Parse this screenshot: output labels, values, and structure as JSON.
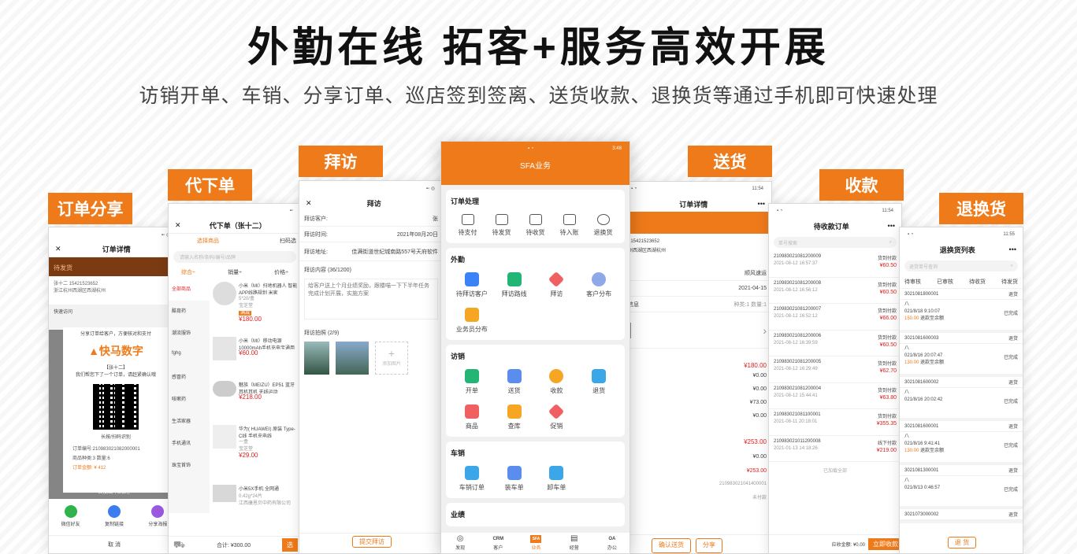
{
  "hero": {
    "title": "外勤在线  拓客+服务高效开展",
    "subtitle": "访销开单、车销、分享订单、巡店签到签离、送货收款、退换货等通过手机即可快速处理"
  },
  "brand_color": "#ef7a1a",
  "tags": {
    "share": "订单分享",
    "proxy": "代下单",
    "visit": "拜访",
    "deliver": "送货",
    "collect": "收款",
    "return": "退换货"
  },
  "phone_share": {
    "nav_title": "订单详情",
    "status": "待发货",
    "customer": "张十二 15421523652",
    "address": "浙江杭州西湖区西湖杭州",
    "shortcut_label": "快速访问",
    "popup_tip": "分享订单给客户，方便核对和支付",
    "logo_text": "快马数字",
    "greeting": "【张十二】",
    "msg": "我们帮您下了一个订单，请赶紧确认哦",
    "qr_caption": "长按/扫码识别",
    "order_no": "订单编号:210983021082000001",
    "goods_count": "商品种类:3    数量:6",
    "amount": "订单金额: ¥ 412",
    "save_hint": "长按图片以保存",
    "share_opts": [
      "微信好友",
      "复制链接",
      "分享海报"
    ],
    "cancel": "取 消"
  },
  "phone_proxy": {
    "nav_title": "代下单（张十二）",
    "tab_select": "选择商品",
    "tab_scan": "扫码选",
    "search_placeholder": "请输入名称/条码/编号/品牌",
    "sorts": [
      "综合÷",
      "销量÷",
      "价格÷"
    ],
    "categories": [
      "全部商品",
      "酷育药",
      "潮流服饰",
      "fghg",
      "感冒药",
      "咳嗽药",
      "生活家器",
      "手机通讯",
      "珠宝首饰"
    ],
    "products": [
      {
        "name": "小米（MI）扫地机器人 智能APP线路规划 米家",
        "spec": "5*20/盒",
        "store": "宝芝堂",
        "badge": "满减",
        "price": "¥180.00"
      },
      {
        "name": "小米（MI）移动电源10000mAh手机充电宝通用",
        "spec": "",
        "store": "",
        "badge": "",
        "price": "¥60.00"
      },
      {
        "name": "魅族（MEIZU）EP51 蓝牙耳机耳机 无线运动",
        "spec": "",
        "store": "",
        "badge": "",
        "price": "¥218.00"
      },
      {
        "name": "华为( HUAWEI) 原装 Type-C线 手机充电线",
        "spec": "一盒",
        "store": "宝芝堂",
        "badge": "",
        "price": "¥29.00"
      },
      {
        "name": "小米5X手机 全网通",
        "spec": "0.42g*24片",
        "store": "江西康恩贝中药有限公司",
        "badge": "",
        "price": ""
      }
    ],
    "total": "合计: ¥300.00",
    "submit": "选"
  },
  "phone_visit": {
    "nav_title": "拜访",
    "fields": [
      {
        "label": "拜访客户:",
        "value": "张"
      },
      {
        "label": "拜访时间:",
        "value": "2021年08月20日"
      },
      {
        "label": "拜访地址:",
        "value": "佳满街道世纪城南路557号天府软件"
      }
    ],
    "content_label": "拜访内容 (36/1200)",
    "content_text": "给客户送上个月业绩奖励，跟楼喵一下下半年任务完成计划开展，实施方案",
    "photo_label": "拜访拍照 (2/9)",
    "add_photo": "添加图片",
    "submit": "提交拜访"
  },
  "phone_sfa": {
    "time": "3:48",
    "title": "SFA业务",
    "sections": [
      {
        "title": "订单处理",
        "items": [
          "待支付",
          "待发货",
          "待收货",
          "待入账",
          "退换货"
        ]
      },
      {
        "title": "外勤",
        "items": [
          "待拜访客户",
          "拜访路线",
          "拜访",
          "客户分布",
          "业务员分布"
        ]
      },
      {
        "title": "访销",
        "items": [
          "开单",
          "送货",
          "收款",
          "退货",
          "商品",
          "查库",
          "促销"
        ]
      },
      {
        "title": "车销",
        "items": [
          "车销订单",
          "装车单",
          "卸车单"
        ]
      },
      {
        "title": "业绩",
        "items": []
      }
    ],
    "tabbar": [
      "发现",
      "客户",
      "业务",
      "经营",
      "办公"
    ]
  },
  "phone_deliver": {
    "time": "11:54",
    "nav_title": "订单详情",
    "phone": ": 15421523652",
    "addr": "州西湖区西湖杭州",
    "express": "顺风速运",
    "date": "2021-04-15",
    "info_label": "信息",
    "info_count": "种类:1 数量:1",
    "amounts": [
      "¥180.00",
      "¥0.00",
      "¥0.00",
      "¥73.00",
      "¥0.00",
      "¥253.00",
      "¥0.00",
      "¥253.00"
    ],
    "order_no": "210983021041400001",
    "status": "未付款",
    "confirm": "确认送货",
    "share": "分享"
  },
  "phone_collect": {
    "time": "11:54",
    "nav_title": "待收款订单",
    "search_placeholder": "单号搜索",
    "orders": [
      {
        "no": "210983021081200009",
        "time": "2021-08-12 16:57:37",
        "type": "货到付款",
        "amt": "¥60.50"
      },
      {
        "no": "210983021081200008",
        "time": "2021-08-12 16:56:12",
        "type": "货到付款",
        "amt": "¥60.50"
      },
      {
        "no": "210983021081200007",
        "time": "2021-08-12 16:52:12",
        "type": "货到付款",
        "amt": "¥66.00"
      },
      {
        "no": "210983021081200006",
        "time": "2021-08-12 16:39:59",
        "type": "货到付款",
        "amt": "¥60.50"
      },
      {
        "no": "210983021081200005",
        "time": "2021-08-12 16:29:49",
        "type": "货到付款",
        "amt": "¥62.70"
      },
      {
        "no": "210983021081200004",
        "time": "2021-08-12 15:44:41",
        "type": "货到付款",
        "amt": "¥63.80"
      },
      {
        "no": "210983021081100001",
        "time": "2021-08-11 20:18:01",
        "type": "货到付款",
        "amt": "¥355.35"
      },
      {
        "no": "210983021011200008",
        "time": "2021-01-13 14:18:26",
        "type": "线下付款",
        "amt": "¥219.00"
      }
    ],
    "end_tip": "已加载全部",
    "due": "应收金额: ¥0.00",
    "collect_all": "立即收款"
  },
  "phone_return": {
    "time": "11:55",
    "nav_title": "退换货列表",
    "search_placeholder": "退货单号查询",
    "tabs": [
      "待审核",
      "已审核",
      "待收货",
      "待发货"
    ],
    "items": [
      {
        "no": "3021081800001",
        "type": "退货",
        "name": "八",
        "time": "021/8/18 9:10:07",
        "money": "150.00",
        "note": "退款至余额",
        "state": "已完成"
      },
      {
        "no": "3021081600003",
        "type": "退货",
        "name": "八",
        "time": "021/8/16 20:07:47",
        "money": "130.00",
        "note": "退款至余额",
        "state": "已完成"
      },
      {
        "no": "3021081600002",
        "type": "退货",
        "name": "八",
        "time": "021/8/16 20:02:42",
        "money": "",
        "note": "",
        "state": "已完成"
      },
      {
        "no": "3021081600001",
        "type": "退货",
        "name": "八",
        "time": "021/8/16 9:41:41",
        "money": "130.00",
        "note": "退款至余额",
        "state": "已完成"
      },
      {
        "no": "3021081300001",
        "type": "退货",
        "name": "八",
        "time": "021/8/13 0:46:57",
        "money": "",
        "note": "",
        "state": "已完成"
      },
      {
        "no": "3021073000002",
        "type": "退货",
        "name": "",
        "time": "",
        "money": "",
        "note": "",
        "state": ""
      }
    ],
    "bottom_btn": "退 货"
  }
}
